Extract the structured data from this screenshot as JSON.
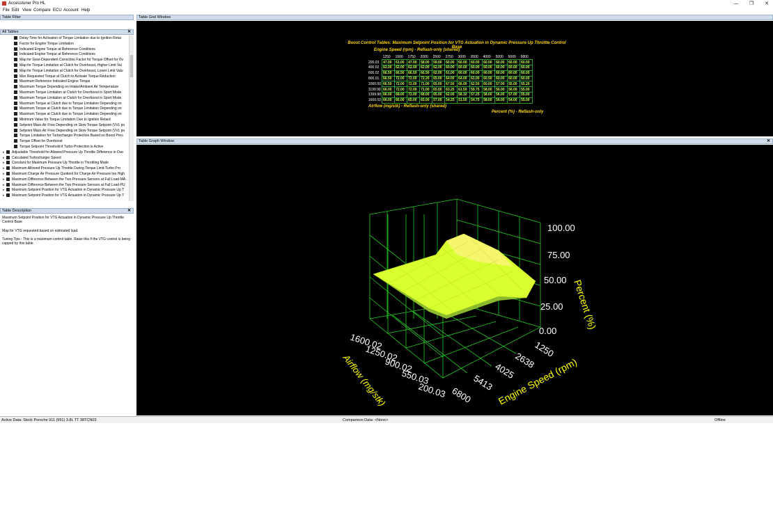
{
  "window": {
    "title": "Accesstuner Pro HL",
    "min": "—",
    "max": "❐",
    "close": "✕"
  },
  "menu": [
    "File",
    "Edit",
    "View",
    "Compare",
    "ECU",
    "Account",
    "Help"
  ],
  "panels": {
    "filter": "Table Filter",
    "all_tables": "All Tables",
    "description": "Table Description",
    "grid": "Table Grid Window",
    "graph": "Table Graph Window",
    "close": "✕"
  },
  "tree_items": [
    {
      "label": "Delay Time for Activation of Torque Limitation due to Ignition Retar",
      "indent": 1
    },
    {
      "label": "Factor for Engine Torque Limitation",
      "indent": 1
    },
    {
      "label": "Indicated Engine Torque at Reference Conditions",
      "indent": 1
    },
    {
      "label": "Indicated Engine Torque at Reference Conditions",
      "indent": 1
    },
    {
      "label": "Map for Gear-Dependent Correction Factor for Torque Offset for Ov",
      "indent": 1
    },
    {
      "label": "Map for Torque Limitation at Clutch for Overboost, Higher Limit Val",
      "indent": 1
    },
    {
      "label": "Map for Torque Limitation at Clutch for Overboost, Lower Limit Valu",
      "indent": 1
    },
    {
      "label": "Max Requested Torque at Clutch to Activate Torque Reduction",
      "indent": 1
    },
    {
      "label": "Maximum Reference Indicated Engine Torque",
      "indent": 1
    },
    {
      "label": "Maximum Torque Depending on Intake/Ambient Air Temperature",
      "indent": 1
    },
    {
      "label": "Maximum Torque Limitation at Clutch for Overboost in Sport Mode",
      "indent": 1
    },
    {
      "label": "Maximum Torque Limitation at Clutch for Overboost in Sport Mode",
      "indent": 1
    },
    {
      "label": "Maximum Torque at Clutch due to Torque Limitation Depending on",
      "indent": 1
    },
    {
      "label": "Maximum Torque at Clutch due to Torque Limitation Depending on",
      "indent": 1
    },
    {
      "label": "Maximum Torque at Clutch due to Torque Limitation Depending on",
      "indent": 1
    },
    {
      "label": "Minimum Value for Torque Limitation Due to Ignition Retard",
      "indent": 1
    },
    {
      "label": "Setpoint Mass Air Flow Depending on Slow Torque Setpoint (VVL po",
      "indent": 1
    },
    {
      "label": "Setpoint Mass Air Flow Depending on Slow Torque Setpoint (VVL po",
      "indent": 1
    },
    {
      "label": "Torque Limitation for Turbocharger Protection Based on Boost Pres",
      "indent": 1
    },
    {
      "label": "Torque Offset for Overboost",
      "indent": 1
    },
    {
      "label": "Torque Setpoint Threshold if Turbo Protection is Active",
      "indent": 1
    },
    {
      "label": "Adjustable Threshold for Allowed Pressure Up Throttle Difference in Ove",
      "indent": 0
    },
    {
      "label": "Calculated Turbocharger Speed",
      "indent": 0
    },
    {
      "label": "Constant for Maximum Pressure Up Throttle in Throttling Mode",
      "indent": 0
    },
    {
      "label": "Maximum Allowed Pressure Up Throttle During Torque Limit-Turbo Pro",
      "indent": 0
    },
    {
      "label": "Maximum Charge Air Pressure Quotient for Charge Air Pressure too High",
      "indent": 0
    },
    {
      "label": "Maximum Difference Between the Two Pressure Sensors at Full Load-MA",
      "indent": 0
    },
    {
      "label": "Maximum Difference Between the Two Pressure Sensors at Full Load-PU",
      "indent": 0
    },
    {
      "label": "Maximum Setpoint Position for VTG Actuation in Dynamic Pressure Up T",
      "indent": 0
    },
    {
      "label": "Maximum Setpoint Position for VTG Actuation in Dynamic Pressure Up T",
      "indent": 0
    }
  ],
  "description": {
    "name": "Maximum Setpoint Position for VTG Actuation in Dynamic Pressure Up Throttle Control Base",
    "summary": "Map for VTG requested based on estimated load.",
    "tips": "Tuning Tips - This is a maximum control table. Raise this if the VTG control is being capped by this table."
  },
  "table": {
    "title": "Boost Control Tables: Maximum Setpoint Position for VTG Actuation in Dynamic Pressure Up Throttle Control Base",
    "x_label": "Engine Speed (rpm) - Reflash-only (shared)",
    "y_label": "Airflow (mg/stk) - Reflash-only (shared)",
    "value_label": "Percent (%) - Reflash-only",
    "columns": [
      "1250",
      "1500",
      "1750",
      "2000",
      "2500",
      "2750",
      "3000",
      "3500",
      "4000",
      "5000",
      "5000",
      "5800"
    ],
    "rows": [
      {
        "h": "200.03",
        "v": [
          "47.00",
          "61.00",
          "47.00",
          "58.00",
          "59.00",
          "60.00",
          "60.00",
          "60.00",
          "60.00",
          "60.00",
          "60.00",
          "60.00"
        ]
      },
      {
        "h": "400.02",
        "v": [
          "62.00",
          "62.00",
          "62.00",
          "62.00",
          "62.00",
          "60.00",
          "60.00",
          "60.00",
          "60.00",
          "60.00",
          "60.00",
          "60.00"
        ]
      },
      {
        "h": "600.02",
        "v": [
          "66.50",
          "66.50",
          "66.50",
          "66.50",
          "62.00",
          "61.00",
          "60.00",
          "60.00",
          "60.00",
          "60.00",
          "60.00",
          "60.00"
        ]
      },
      {
        "h": "800.01",
        "v": [
          "66.50",
          "72.00",
          "72.00",
          "72.20",
          "65.00",
          "64.00",
          "64.00",
          "61.00",
          "60.50",
          "60.00",
          "60.00",
          "60.00"
        ]
      },
      {
        "h": "1000.00",
        "v": [
          "66.50",
          "72.00",
          "72.00",
          "71.00",
          "65.00",
          "67.50",
          "66.00",
          "62.50",
          "60.00",
          "57.00",
          "55.00",
          "55.20"
        ]
      },
      {
        "h": "1199.99",
        "v": [
          "66.00",
          "72.00",
          "72.00",
          "71.00",
          "65.00",
          "63.25",
          "61.50",
          "59.75",
          "58.00",
          "56.00",
          "56.00",
          "55.00"
        ]
      },
      {
        "h": "1399.98",
        "v": [
          "66.00",
          "68.00",
          "72.00",
          "68.00",
          "65.00",
          "62.00",
          "58.10",
          "57.25",
          "58.00",
          "56.00",
          "57.00",
          "55.00"
        ]
      },
      {
        "h": "1600.02",
        "v": [
          "66.00",
          "66.00",
          "65.00",
          "65.00",
          "57.00",
          "54.25",
          "51.50",
          "54.75",
          "58.00",
          "56.00",
          "54.00",
          "55.00"
        ]
      }
    ]
  },
  "graph": {
    "x_axis_title": "Engine Speed (rpm)",
    "y_axis_title": "Airflow (mg/stk)",
    "z_axis_title": "Percent (%)",
    "x_ticks": [
      "1250",
      "2638",
      "4025",
      "5413",
      "6800"
    ],
    "y_ticks": [
      "1600.02",
      "1250.02",
      "900.02",
      "550.03",
      "200.03"
    ],
    "z_ticks": [
      "100.00",
      "75.00",
      "50.00",
      "25.00",
      "0.00"
    ]
  },
  "status": {
    "active": "Active Data: Stock Porsche 911 (991) 3.8L TT 38TCN03",
    "comparison": "Comparison Data: <None>",
    "mode": "Offline"
  },
  "colors": {
    "surface": "#ffff33",
    "surface_dark": "#9acd32",
    "grid": "#22cc22",
    "text": "#ffff00"
  }
}
